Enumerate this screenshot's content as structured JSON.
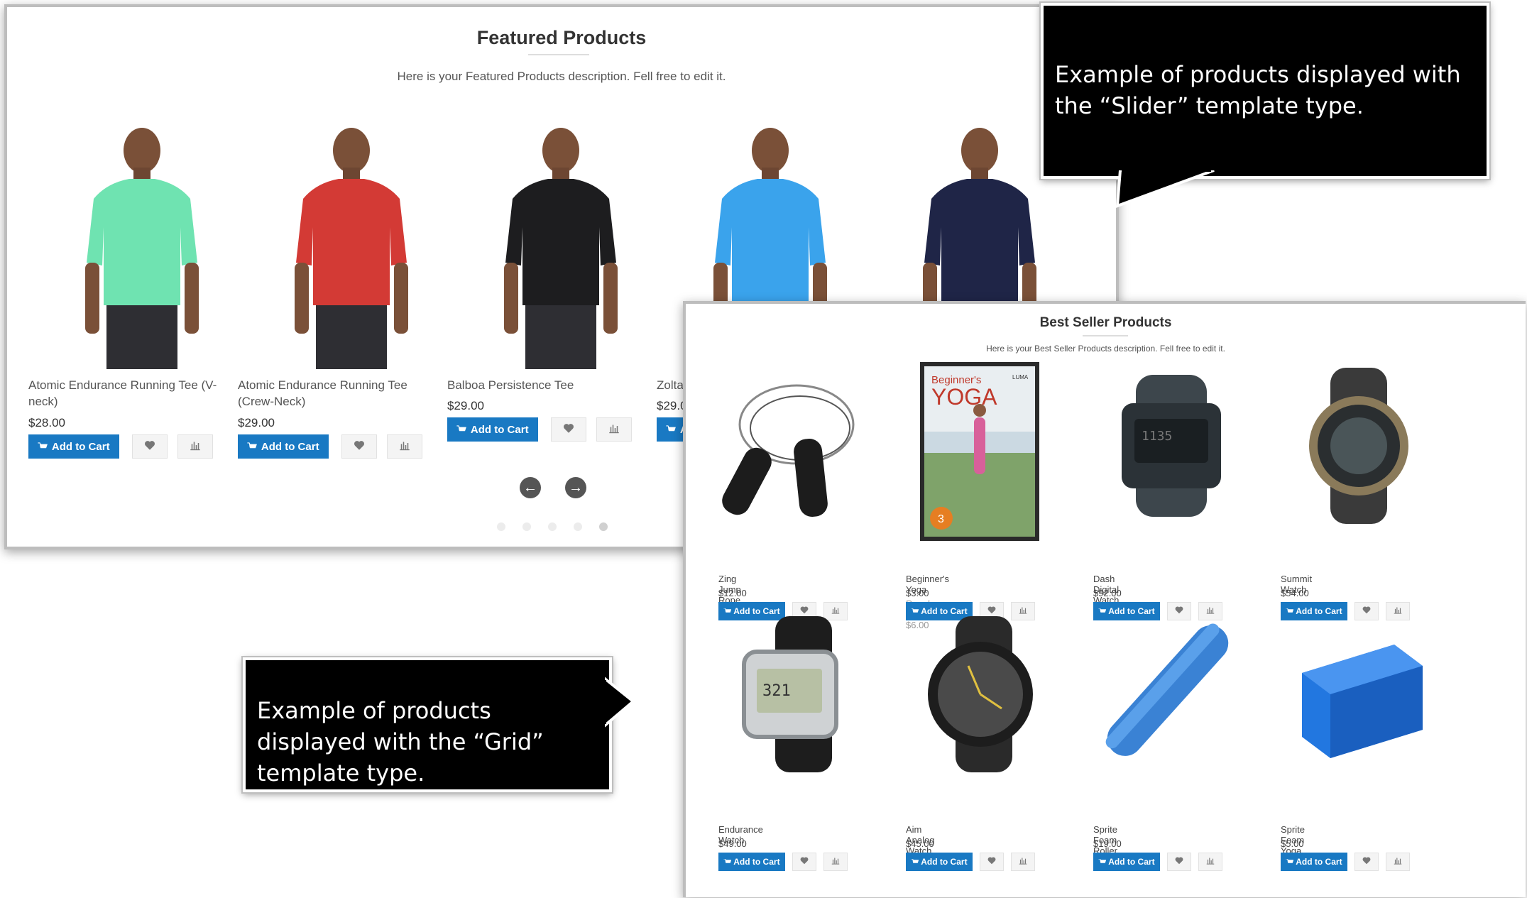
{
  "featured": {
    "title": "Featured Products",
    "description": "Here is your Featured Products description. Fell free to edit it.",
    "products": [
      {
        "name": "Atomic Endurance Running Tee (V-neck)",
        "price": "$28.00",
        "shirt_color": "#6fe3b1"
      },
      {
        "name": "Atomic Endurance Running Tee (Crew-Neck)",
        "price": "$29.00",
        "shirt_color": "#d33a35"
      },
      {
        "name": "Balboa Persistence Tee",
        "price": "$29.00",
        "shirt_color": "#1d1d1f"
      },
      {
        "name": "Zolta",
        "price": "$29.0",
        "shirt_color": "#3aa3ec"
      },
      {
        "name": "",
        "price": "",
        "shirt_color": "#1f2547"
      }
    ],
    "add_to_cart_label": "Add to Cart",
    "prev_label": "←",
    "next_label": "→"
  },
  "bestseller": {
    "title": "Best Seller Products",
    "description": "Here is your Best Seller Products description. Fell free to edit it.",
    "add_to_cart_label": "Add to Cart",
    "products": [
      {
        "name": "Zing Jump Rope",
        "price": "$12.00",
        "regular": ""
      },
      {
        "name": "Beginner's Yoga",
        "price": "$3.00",
        "regular": "Regular Price $6.00"
      },
      {
        "name": "Dash Digital Watch",
        "price": "$92.00",
        "regular": ""
      },
      {
        "name": "Summit Watch",
        "price": "$54.00",
        "regular": ""
      },
      {
        "name": "Endurance Watch",
        "price": "$49.00",
        "regular": ""
      },
      {
        "name": "Aim Analog Watch",
        "price": "$45.00",
        "regular": ""
      },
      {
        "name": "Sprite Foam Roller",
        "price": "$19.00",
        "regular": ""
      },
      {
        "name": "Sprite Foam Yoga Brick",
        "price": "$5.00",
        "regular": ""
      }
    ],
    "dvd": {
      "title_small": "Beginner's",
      "title_big": "YOGA",
      "brand": "LUMA",
      "badge": "3"
    }
  },
  "callouts": {
    "slider": "Example of products displayed with the “Slider” template type.",
    "grid": "Example of products displayed with the “Grid” template type."
  },
  "colors": {
    "accent": "#1979c3",
    "callout_bg": "#000000"
  },
  "icons": {
    "cart": "cart-icon",
    "wishlist": "heart-icon",
    "compare": "bar-chart-icon",
    "prev": "arrow-left-icon",
    "next": "arrow-right-icon"
  }
}
